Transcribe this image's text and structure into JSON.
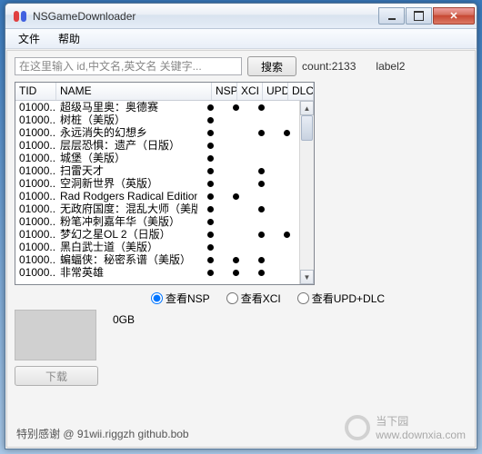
{
  "window": {
    "title": "NSGameDownloader"
  },
  "menu": {
    "file": "文件",
    "help": "帮助"
  },
  "search": {
    "placeholder": "在这里输入 id,中文名,英文名 关键字...",
    "button": "搜索"
  },
  "status": {
    "count_label": "count:2133",
    "label2": "label2"
  },
  "table": {
    "headers": {
      "tid": "TID",
      "name": "NAME",
      "nsp": "NSP",
      "xci": "XCI",
      "upd": "UPD",
      "dlc": "DLC"
    },
    "rows": [
      {
        "tid": "01000...",
        "name": "超级马里奥：奥德赛",
        "nsp": true,
        "xci": true,
        "upd": true,
        "dlc": false
      },
      {
        "tid": "01000...",
        "name": "树桩（美版）",
        "nsp": true,
        "xci": false,
        "upd": false,
        "dlc": false
      },
      {
        "tid": "01000...",
        "name": "永远消失的幻想乡",
        "nsp": true,
        "xci": false,
        "upd": true,
        "dlc": true
      },
      {
        "tid": "01000...",
        "name": "层层恐惧：遗产（日版）",
        "nsp": true,
        "xci": false,
        "upd": false,
        "dlc": false
      },
      {
        "tid": "01000...",
        "name": "城堡（美版）",
        "nsp": true,
        "xci": false,
        "upd": false,
        "dlc": false
      },
      {
        "tid": "01000...",
        "name": "扫雷天才",
        "nsp": true,
        "xci": false,
        "upd": true,
        "dlc": false
      },
      {
        "tid": "01000...",
        "name": "空洞新世界（英版）",
        "nsp": true,
        "xci": false,
        "upd": true,
        "dlc": false
      },
      {
        "tid": "01000...",
        "name": "Rad Rodgers Radical Edition(US)(eShop)",
        "nsp": true,
        "xci": true,
        "upd": false,
        "dlc": false
      },
      {
        "tid": "01000...",
        "name": "无政府国度：混乱大师（美版）",
        "nsp": true,
        "xci": false,
        "upd": true,
        "dlc": false
      },
      {
        "tid": "01000...",
        "name": "粉笔冲刺嘉年华（美版）",
        "nsp": true,
        "xci": false,
        "upd": false,
        "dlc": false
      },
      {
        "tid": "01000...",
        "name": "梦幻之星OL 2（日版）",
        "nsp": true,
        "xci": false,
        "upd": true,
        "dlc": true
      },
      {
        "tid": "01000...",
        "name": "黑白武士道（美版）",
        "nsp": true,
        "xci": false,
        "upd": false,
        "dlc": false
      },
      {
        "tid": "01000...",
        "name": "蝙蝠侠：秘密系谱（美版）",
        "nsp": true,
        "xci": true,
        "upd": true,
        "dlc": false
      },
      {
        "tid": "01000...",
        "name": "非常英雄",
        "nsp": true,
        "xci": true,
        "upd": true,
        "dlc": false
      }
    ]
  },
  "radios": {
    "nsp": "查看NSP",
    "xci": "查看XCI",
    "upddlc": "查看UPD+DLC"
  },
  "preview": {
    "size": "0GB"
  },
  "download": {
    "label": "下载"
  },
  "footer": {
    "thanks": "特别感谢 @ 91wii.riggzh  github.bob"
  },
  "watermark": {
    "site": "当下园",
    "url": "www.downxia.com"
  }
}
